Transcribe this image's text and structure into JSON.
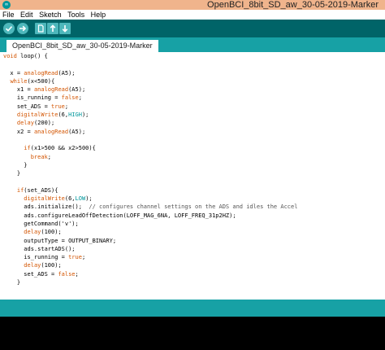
{
  "window": {
    "title": "OpenBCI_8bit_SD_aw_30-05-2019-Marker",
    "icon": "arduino-icon"
  },
  "menu": [
    "File",
    "Edit",
    "Sketch",
    "Tools",
    "Help"
  ],
  "toolbar": {
    "buttons": [
      {
        "name": "verify-button",
        "icon": "check-icon"
      },
      {
        "name": "upload-button",
        "icon": "arrow-right-icon"
      },
      {
        "name": "new-button",
        "icon": "new-file-icon"
      },
      {
        "name": "open-button",
        "icon": "arrow-up-icon"
      },
      {
        "name": "save-button",
        "icon": "arrow-down-icon"
      }
    ]
  },
  "tab": {
    "label": "OpenBCI_8bit_SD_aw_30-05-2019-Marker"
  },
  "code": [
    "void loop() {",
    "",
    "  x = analogRead(A5);",
    "  while(x<500){",
    "    x1 = analogRead(A5);",
    "    is_running = false;",
    "    set_ADS = true;",
    "    digitalWrite(6,HIGH);",
    "    delay(200);",
    "    x2 = analogRead(A5);",
    "",
    "      if(x1>500 && x2>500){",
    "        break;",
    "      }",
    "    }",
    "",
    "    if(set_ADS){",
    "      digitalWrite(6,LOW);",
    "      ads.initialize();  // configures channel settings on the ADS and idles the Accel",
    "      ads.configureLeadOffDetection(LOFF_MAG_6NA, LOFF_FREQ_31p2HZ);",
    "      getCommand('v');",
    "      delay(100);",
    "      outputType = OUTPUT_BINARY;",
    "      ads.startADS();",
    "      is_running = true;",
    "      delay(100);",
    "      set_ADS = false;",
    "    }"
  ],
  "colors": {
    "titlebar": "#f0b48c",
    "toolbar": "#006468",
    "tabbar": "#17a1a5",
    "keyword": "#d35400",
    "literal": "#00979c",
    "console": "#000000"
  }
}
